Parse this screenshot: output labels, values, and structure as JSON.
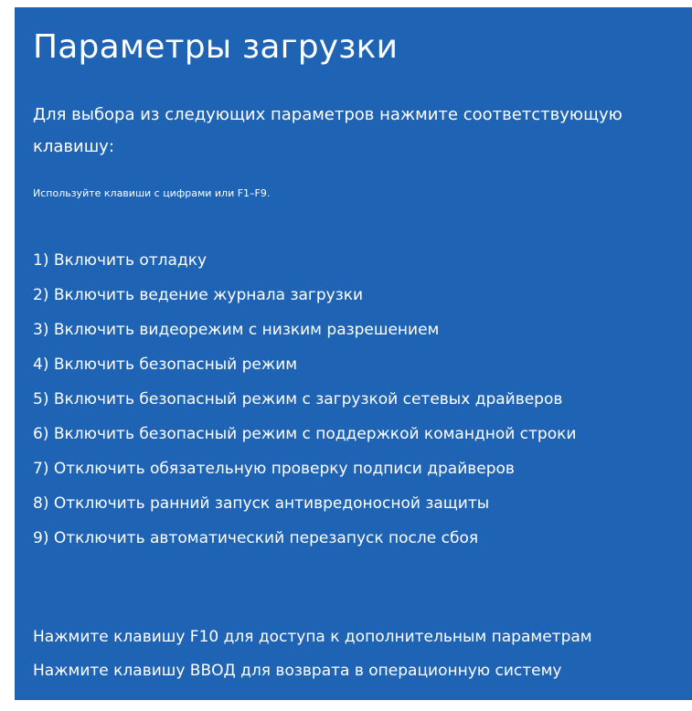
{
  "screen": {
    "title": "Параметры загрузки",
    "subtitle_line1": "Для выбора из следующих параметров нажмите соответствующую",
    "subtitle_line2": "клавишу:",
    "hint": "Используйте клавиши с цифрами или F1–F9.",
    "options": [
      "1) Включить отладку",
      "2) Включить ведение журнала загрузки",
      "3) Включить видеорежим с низким разрешением",
      "4) Включить безопасный режим",
      "5) Включить безопасный режим с загрузкой сетевых драйверов",
      "6) Включить безопасный режим с поддержкой командной строки",
      "7) Отключить обязательную проверку подписи драйверов",
      "8) Отключить ранний запуск антивредоносной защиты",
      "9) Отключить автоматический перезапуск после сбоя"
    ],
    "footer_f10": "Нажмите клавишу F10 для доступа к дополнительным параметрам",
    "footer_enter": "Нажмите клавишу ВВОД для возврата в операционную систему"
  },
  "colors": {
    "background": "#1f63b5",
    "text": "#ffffff"
  }
}
